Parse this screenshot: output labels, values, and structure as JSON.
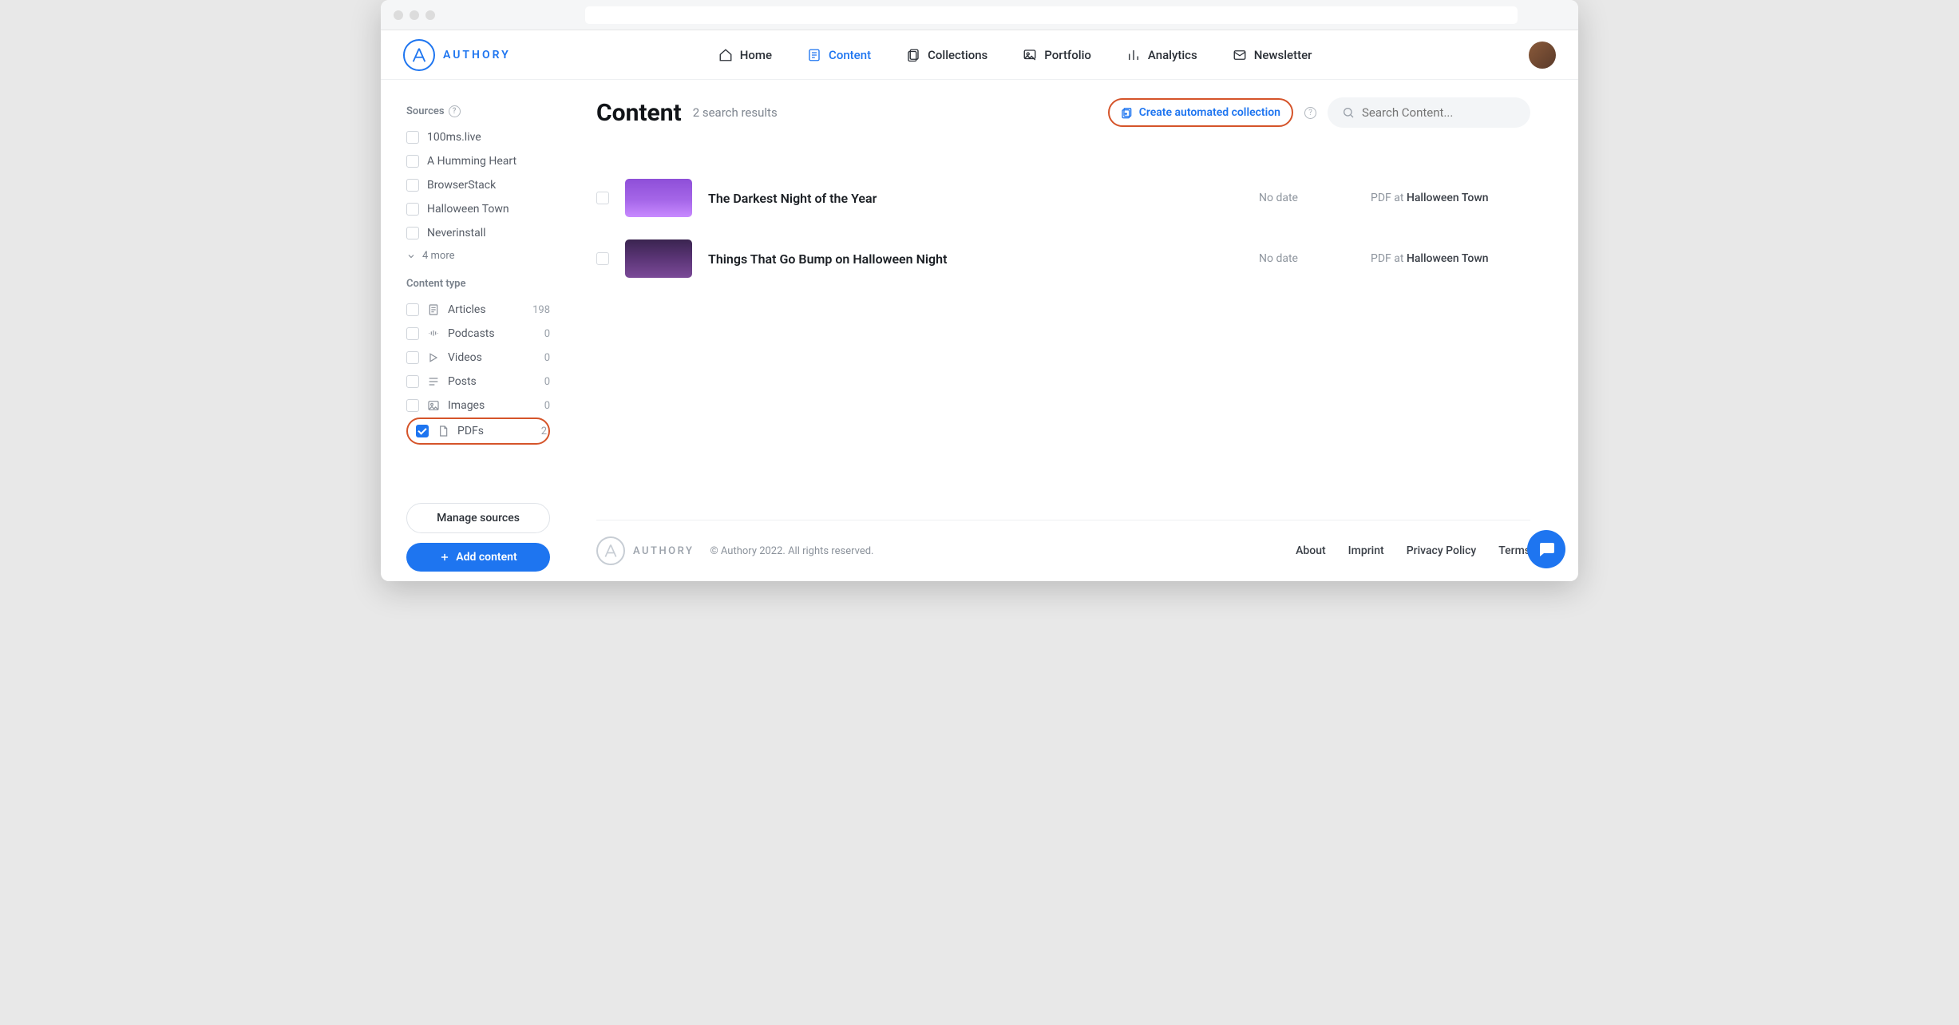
{
  "brand": {
    "name": "AUTHORY"
  },
  "nav": {
    "items": [
      {
        "label": "Home"
      },
      {
        "label": "Content"
      },
      {
        "label": "Collections"
      },
      {
        "label": "Portfolio"
      },
      {
        "label": "Analytics"
      },
      {
        "label": "Newsletter"
      }
    ],
    "active_index": 1
  },
  "sidebar": {
    "sources_label": "Sources",
    "sources": [
      {
        "label": "100ms.live"
      },
      {
        "label": "A Humming Heart"
      },
      {
        "label": "BrowserStack"
      },
      {
        "label": "Halloween Town"
      },
      {
        "label": "Neverinstall"
      }
    ],
    "more_label": "4 more",
    "content_type_label": "Content type",
    "types": [
      {
        "label": "Articles",
        "count": "198",
        "checked": false
      },
      {
        "label": "Podcasts",
        "count": "0",
        "checked": false
      },
      {
        "label": "Videos",
        "count": "0",
        "checked": false
      },
      {
        "label": "Posts",
        "count": "0",
        "checked": false
      },
      {
        "label": "Images",
        "count": "0",
        "checked": false
      },
      {
        "label": "PDFs",
        "count": "2",
        "checked": true
      }
    ],
    "manage_sources_label": "Manage sources",
    "add_content_label": "Add content"
  },
  "main": {
    "title": "Content",
    "result_text": "2 search results",
    "create_label": "Create automated collection",
    "search_placeholder": "Search Content...",
    "rows": [
      {
        "title": "The Darkest Night of the Year",
        "date": "No date",
        "type": "PDF",
        "at": "at",
        "source": "Halloween Town"
      },
      {
        "title": "Things That Go Bump on Halloween Night",
        "date": "No date",
        "type": "PDF",
        "at": "at",
        "source": "Halloween Town"
      }
    ]
  },
  "footer": {
    "brand": "AUTHORY",
    "copyright": "© Authory 2022. All rights reserved.",
    "links": [
      {
        "label": "About"
      },
      {
        "label": "Imprint"
      },
      {
        "label": "Privacy Policy"
      },
      {
        "label": "Terms"
      }
    ]
  }
}
